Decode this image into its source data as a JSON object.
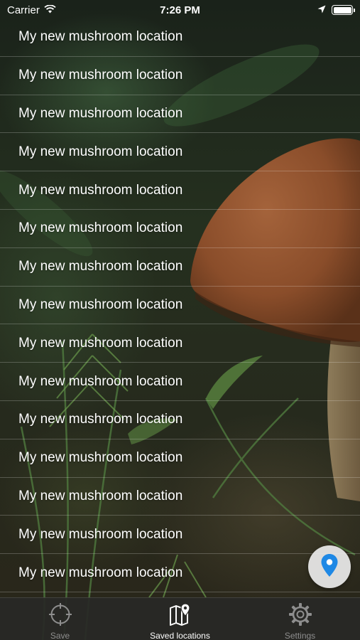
{
  "status_bar": {
    "carrier": "Carrier",
    "time": "7:26 PM"
  },
  "locations": [
    {
      "label": "My new mushroom location"
    },
    {
      "label": "My new mushroom location"
    },
    {
      "label": "My new mushroom location"
    },
    {
      "label": "My new mushroom location"
    },
    {
      "label": "My new mushroom location"
    },
    {
      "label": "My new mushroom location"
    },
    {
      "label": "My new mushroom location"
    },
    {
      "label": "My new mushroom location"
    },
    {
      "label": "My new mushroom location"
    },
    {
      "label": "My new mushroom location"
    },
    {
      "label": "My new mushroom location"
    },
    {
      "label": "My new mushroom location"
    },
    {
      "label": "My new mushroom location"
    },
    {
      "label": "My new mushroom location"
    },
    {
      "label": "My new mushroom location"
    }
  ],
  "fab": {
    "icon": "map-pin-icon",
    "color": "#1e88e5"
  },
  "tabs": [
    {
      "label": "Save",
      "icon": "crosshair-icon",
      "active": false
    },
    {
      "label": "Saved locations",
      "icon": "map-pin-list-icon",
      "active": true
    },
    {
      "label": "Settings",
      "icon": "gear-icon",
      "active": false
    }
  ]
}
